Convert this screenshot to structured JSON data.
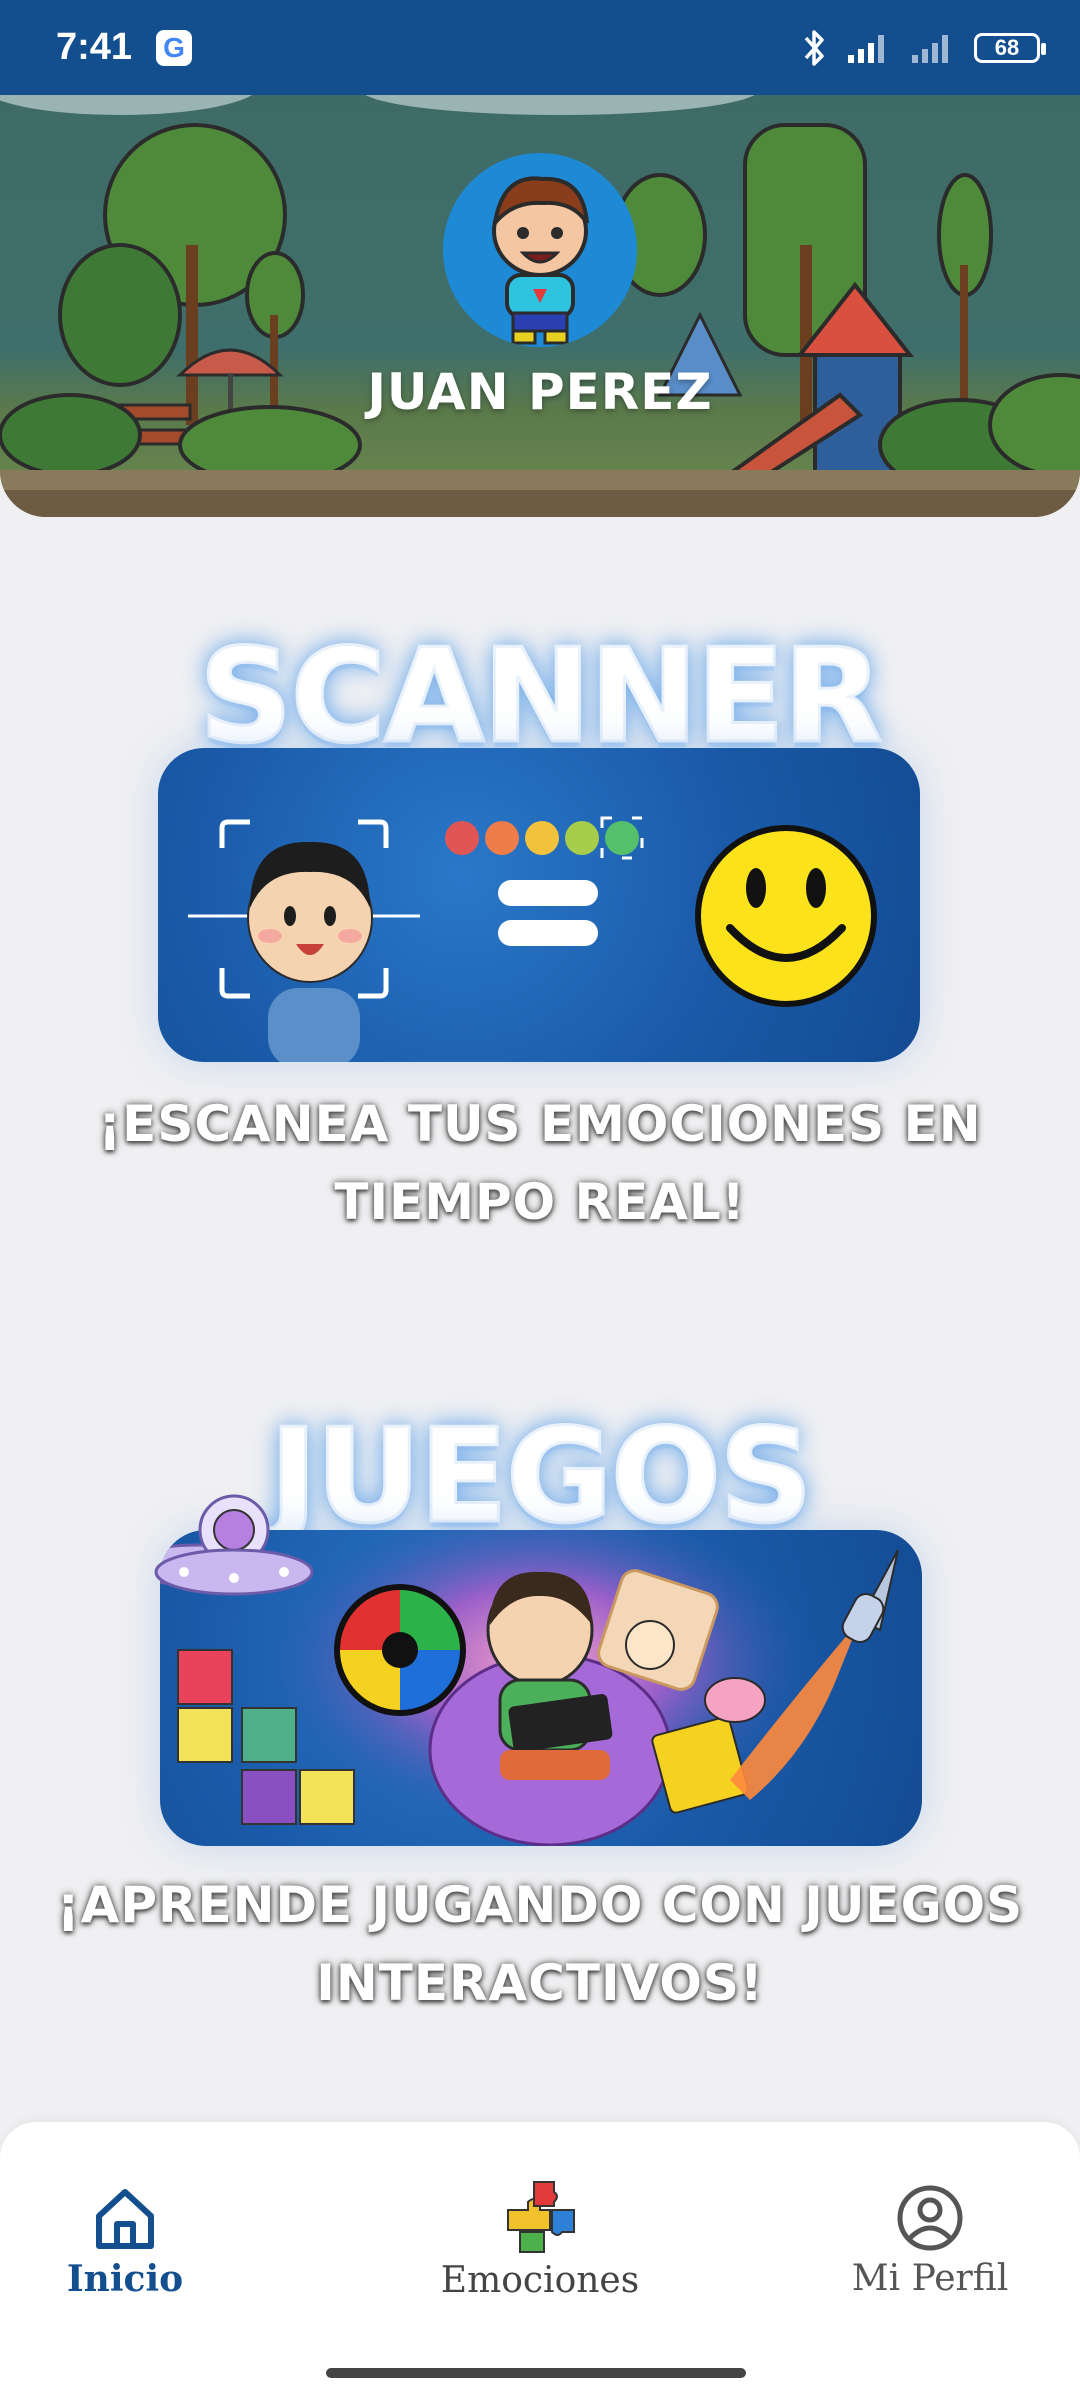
{
  "status_bar": {
    "time": "7:41",
    "notification_icon": "google-g-icon",
    "battery": "68",
    "icons": [
      "bluetooth-icon",
      "signal-icon",
      "signal-icon",
      "battery-icon"
    ]
  },
  "header": {
    "name": "JUAN PEREZ",
    "avatar_icon": "boy-avatar-icon"
  },
  "scanner": {
    "title": "SCANNER",
    "caption_line1": "¡ESCANEA TUS EMOCIONES EN",
    "caption_line2": "TIEMPO REAL!"
  },
  "juegos": {
    "title": "JUEGOS",
    "caption_line1": "¡APRENDE JUGANDO CON JUEGOS",
    "caption_line2": "INTERACTIVOS!"
  },
  "nav": {
    "items": [
      {
        "label": "Inicio",
        "icon": "home-icon",
        "active": true
      },
      {
        "label": "Emociones",
        "icon": "puzzle-icon",
        "active": false
      },
      {
        "label": "Mi Perfil",
        "icon": "user-circle-icon",
        "active": false
      }
    ]
  },
  "colors": {
    "primary": "#134f8f",
    "active_nav": "#134f8f",
    "inactive_nav": "#555555",
    "background": "#f0f0f2"
  }
}
